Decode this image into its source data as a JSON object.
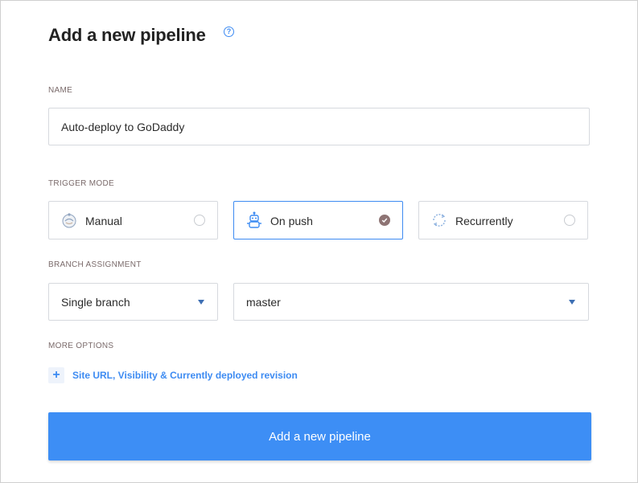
{
  "title": "Add a new pipeline",
  "help_icon": "question-circle-icon",
  "name_section": {
    "label": "NAME",
    "value": "Auto-deploy to GoDaddy"
  },
  "trigger_section": {
    "label": "TRIGGER MODE",
    "options": [
      {
        "label": "Manual",
        "icon": "manual-hand-icon",
        "selected": false
      },
      {
        "label": "On push",
        "icon": "robot-icon",
        "selected": true
      },
      {
        "label": "Recurrently",
        "icon": "recurring-cycle-icon",
        "selected": false
      }
    ]
  },
  "branch_section": {
    "label": "BRANCH ASSIGNMENT",
    "mode": "Single branch",
    "branch": "master"
  },
  "more_options": {
    "label": "MORE OPTIONS",
    "link": "Site URL, Visibility & Currently deployed revision"
  },
  "submit_label": "Add a new pipeline",
  "colors": {
    "accent": "#3d8ef5",
    "selected_radio": "#8e7474",
    "border": "#d6d9de"
  }
}
